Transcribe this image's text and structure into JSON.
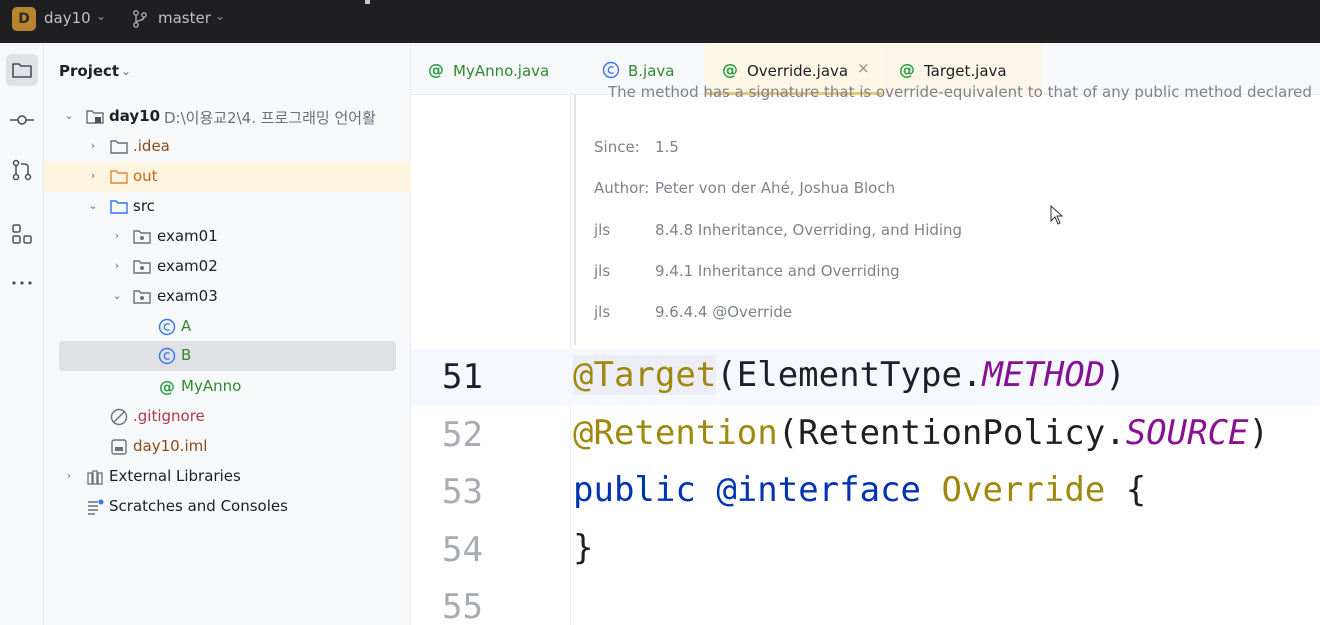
{
  "titlebar": {
    "project_badge": "D",
    "project_name": "day10",
    "branch": "master"
  },
  "tool_stripe": {
    "items": [
      "folder-icon",
      "commit-icon",
      "pull-requests-icon",
      "structure-icon",
      "more-icon"
    ]
  },
  "project_panel": {
    "title": "Project",
    "tree": [
      {
        "label": "day10",
        "path": "D:\\이용교2\\4. 프로그래밍 언어활"
      },
      {
        "label": ".idea"
      },
      {
        "label": "out"
      },
      {
        "label": "src"
      },
      {
        "label": "exam01"
      },
      {
        "label": "exam02"
      },
      {
        "label": "exam03"
      },
      {
        "label": "A"
      },
      {
        "label": "B"
      },
      {
        "label": "MyAnno"
      },
      {
        "label": ".gitignore"
      },
      {
        "label": "day10.iml"
      },
      {
        "label": "External Libraries"
      },
      {
        "label": "Scratches and Consoles"
      }
    ]
  },
  "tabs": [
    {
      "label": "MyAnno.java"
    },
    {
      "label": "B.java"
    },
    {
      "label": "Override.java",
      "close": "×"
    },
    {
      "label": "Target.java"
    }
  ],
  "doc": {
    "cut_line": "The method has a signature that is override-equivalent to that of any public method declared",
    "rows": [
      {
        "key": "Since:",
        "value": "1.5"
      },
      {
        "key": "Author:",
        "value": "Peter von der Ahé, Joshua Bloch"
      },
      {
        "key": "jls",
        "value": "8.4.8 Inheritance, Overriding, and Hiding"
      },
      {
        "key": "jls",
        "value": "9.4.1 Inheritance and Overriding"
      },
      {
        "key": "jls",
        "value": "9.6.4.4 @Override"
      }
    ]
  },
  "code": {
    "line_numbers": [
      "51",
      "52",
      "53",
      "54",
      "55"
    ],
    "line51": {
      "annot": "@Target",
      "open": "(ElementType.",
      "field": "METHOD",
      "close": ")"
    },
    "line52": {
      "annot": "@Retention",
      "open": "(RetentionPolicy.",
      "field": "SOURCE",
      "close": ")"
    },
    "line53": {
      "kw1": "public",
      "kw2": "@interface",
      "name": "Override",
      "brace": "{"
    },
    "line54": {
      "brace": "}"
    }
  }
}
